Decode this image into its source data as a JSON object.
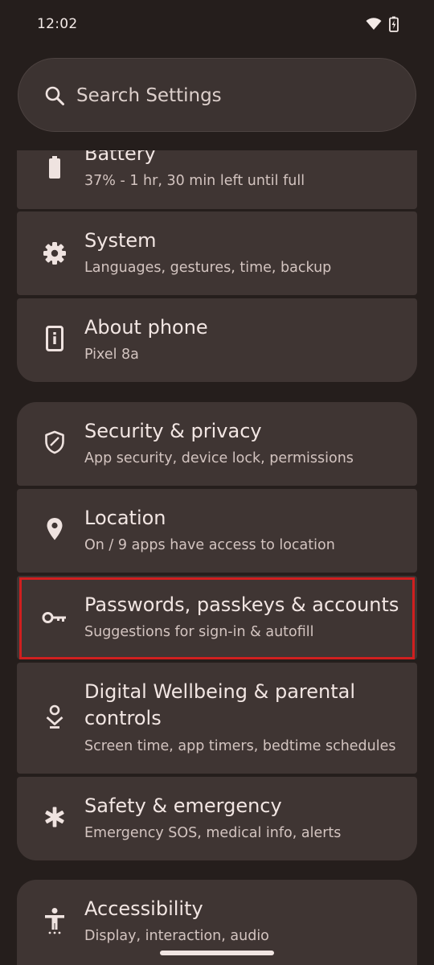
{
  "status_bar": {
    "time": "12:02",
    "icons": [
      "wifi-icon",
      "battery-charging-icon"
    ]
  },
  "search": {
    "placeholder": "Search Settings",
    "icon": "search-icon"
  },
  "items": [
    {
      "title": "Battery",
      "subtitle": "37% - 1 hr, 30 min left until full",
      "icon": "battery-icon"
    },
    {
      "title": "System",
      "subtitle": "Languages, gestures, time, backup",
      "icon": "gear-icon"
    },
    {
      "title": "About phone",
      "subtitle": "Pixel 8a",
      "icon": "phone-info-icon"
    },
    {
      "title": "Security & privacy",
      "subtitle": "App security, device lock, permissions",
      "icon": "shield-icon"
    },
    {
      "title": "Location",
      "subtitle": "On / 9 apps have access to location",
      "icon": "location-pin-icon"
    },
    {
      "title": "Passwords, passkeys & accounts",
      "subtitle": "Suggestions for sign-in & autofill",
      "icon": "key-icon"
    },
    {
      "title": "Digital Wellbeing & parental controls",
      "subtitle": "Screen time, app timers, bedtime schedules",
      "icon": "wellbeing-icon"
    },
    {
      "title": "Safety & emergency",
      "subtitle": "Emergency SOS, medical info, alerts",
      "icon": "asterisk-icon"
    },
    {
      "title": "Accessibility",
      "subtitle": "Display, interaction, audio",
      "icon": "accessibility-icon"
    }
  ],
  "colors": {
    "background": "#251e1c",
    "card": "#3f3533",
    "highlight": "#d01f1f",
    "text": "#f2e6e3",
    "subtext": "#d3c4c0"
  }
}
